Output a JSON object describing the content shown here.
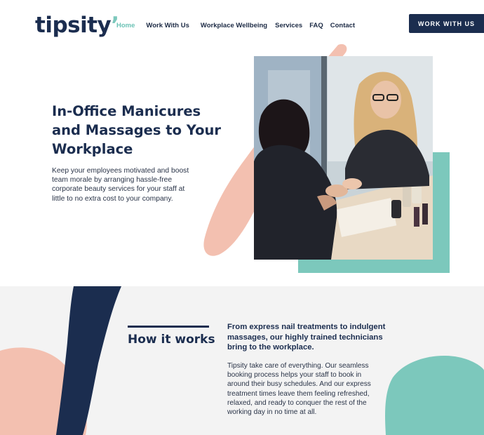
{
  "header": {
    "logo_text": "tipsity",
    "logo_accent_char": "’",
    "nav": [
      {
        "label": "Home",
        "active": true
      },
      {
        "label": "Work With Us",
        "active": false
      },
      {
        "label": "Workplace Wellbeing",
        "active": false
      },
      {
        "label": "Services",
        "active": false
      },
      {
        "label": "FAQ",
        "active": false
      },
      {
        "label": "Contact",
        "active": false
      }
    ],
    "cta_label": "WORK WITH US"
  },
  "hero": {
    "title": "In-Office Manicures and Massages to Your Workplace",
    "description": "Keep your employees motivated and boost team morale by arranging hassle-free corporate beauty services for your staff at little to no extra cost to your company."
  },
  "how_it_works": {
    "heading": "How it works",
    "lead": "From express nail treatments to indulgent massages, our highly trained technicians bring  to the workplace.",
    "body": "Tipsity take care of everything. Our seamless booking process helps your staff to book in around their busy schedules. And our express treatment times leave them feeling refreshed, relaxed, and ready to conquer the rest of the working day in no time at all."
  },
  "colors": {
    "navy": "#1b2d4f",
    "teal": "#7cc8bc",
    "peach": "#f3c0b0",
    "light_bg": "#f3f3f3"
  }
}
